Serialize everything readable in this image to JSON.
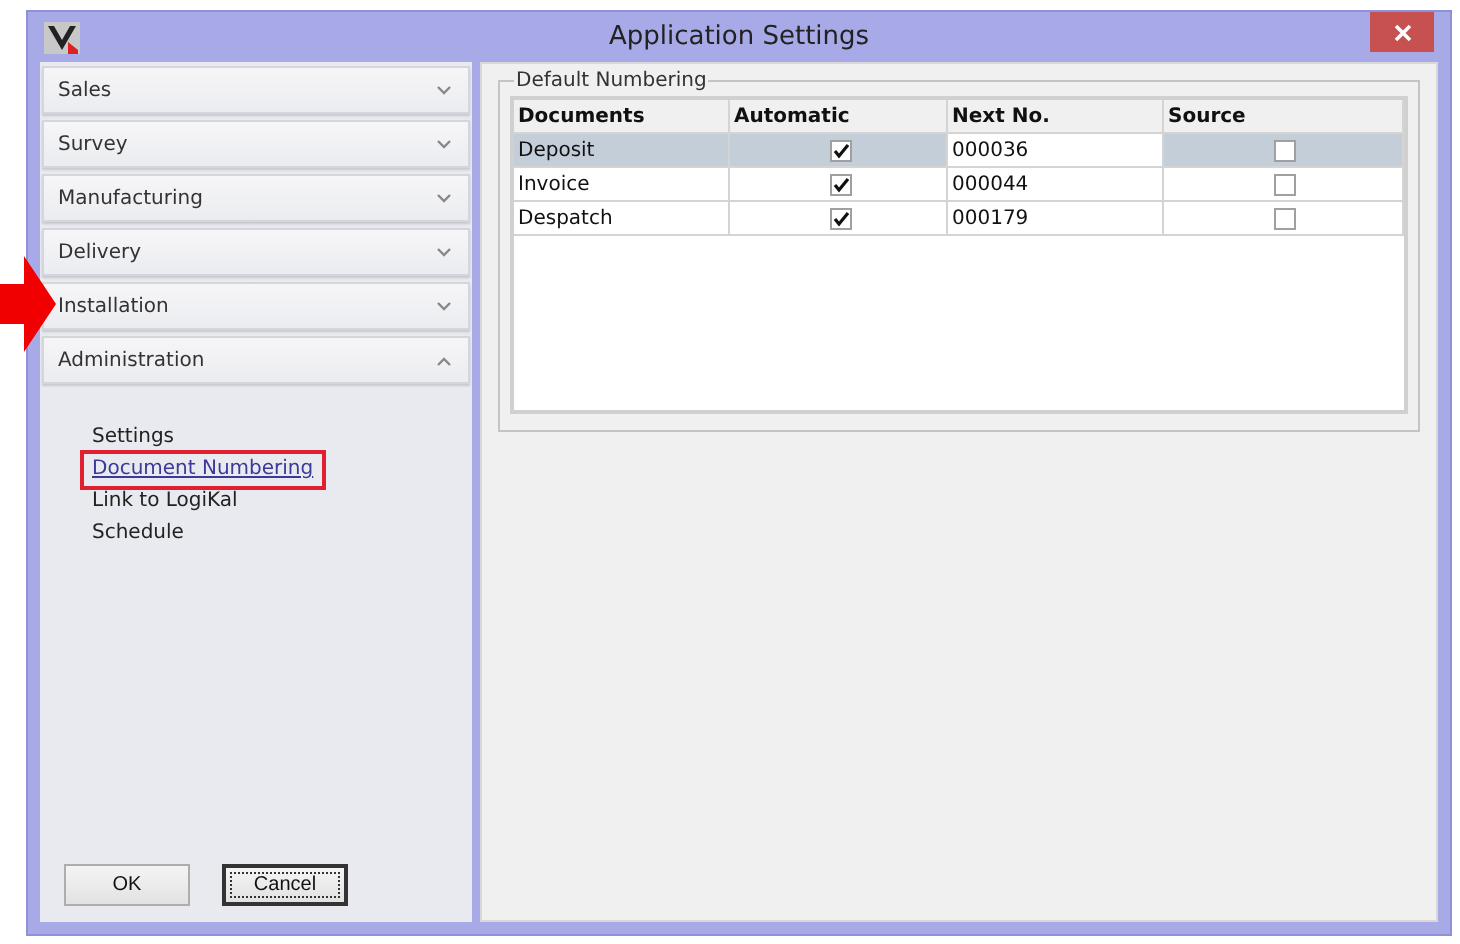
{
  "window": {
    "title": "Application Settings"
  },
  "sidebar": {
    "sections": [
      {
        "label": "Sales",
        "expanded": false
      },
      {
        "label": "Survey",
        "expanded": false
      },
      {
        "label": "Manufacturing",
        "expanded": false
      },
      {
        "label": "Delivery",
        "expanded": false
      },
      {
        "label": "Installation",
        "expanded": false
      },
      {
        "label": "Administration",
        "expanded": true,
        "children": [
          {
            "label": "Settings",
            "selected": false
          },
          {
            "label": "Document Numbering",
            "selected": true
          },
          {
            "label": "Link to LogiKal",
            "selected": false
          },
          {
            "label": "Schedule",
            "selected": false
          }
        ]
      }
    ]
  },
  "numbering": {
    "group_title": "Default Numbering",
    "columns": [
      "Documents",
      "Automatic",
      "Next No.",
      "Source"
    ],
    "rows": [
      {
        "document": "Deposit",
        "automatic": true,
        "next_no": "000036",
        "source": false,
        "selected": true
      },
      {
        "document": "Invoice",
        "automatic": true,
        "next_no": "000044",
        "source": false,
        "selected": false
      },
      {
        "document": "Despatch",
        "automatic": true,
        "next_no": "000179",
        "source": false,
        "selected": false
      }
    ]
  },
  "buttons": [
    {
      "label": "OK",
      "focused": false
    },
    {
      "label": "Cancel",
      "focused": true
    }
  ]
}
